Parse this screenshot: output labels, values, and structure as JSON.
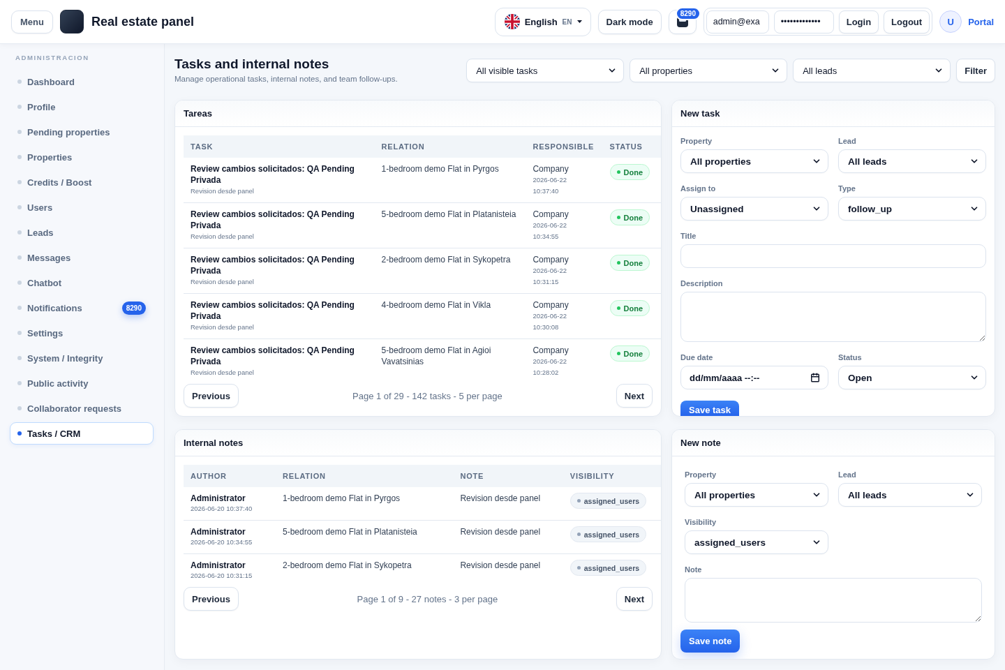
{
  "header": {
    "menu_button": "Menu",
    "brand": "Real estate panel",
    "language": {
      "label": "English",
      "code": "EN"
    },
    "dark_mode_button": "Dark mode",
    "notification_badge": "8290",
    "login": {
      "email": {
        "value": "admin@exa"
      },
      "password": {
        "value": "•••••••••••••"
      },
      "login_button": "Login",
      "logout_button": "Logout"
    },
    "avatar": "U",
    "portal_link": "Portal"
  },
  "sidebar": {
    "section": "ADMINISTRACION",
    "items": [
      {
        "label": "Dashboard",
        "selected": false
      },
      {
        "label": "Profile",
        "selected": false
      },
      {
        "label": "Pending properties",
        "selected": false
      },
      {
        "label": "Properties",
        "selected": false
      },
      {
        "label": "Credits / Boost",
        "selected": false
      },
      {
        "label": "Users",
        "selected": false
      },
      {
        "label": "Leads",
        "selected": false
      },
      {
        "label": "Messages",
        "selected": false
      },
      {
        "label": "Chatbot",
        "selected": false
      },
      {
        "label": "Notifications",
        "selected": false,
        "badge": "8290"
      },
      {
        "label": "Settings",
        "selected": false
      },
      {
        "label": "System / Integrity",
        "selected": false
      },
      {
        "label": "Public activity",
        "selected": false
      },
      {
        "label": "Collaborator requests",
        "selected": false
      },
      {
        "label": "Tasks / CRM",
        "selected": true
      }
    ]
  },
  "page": {
    "title": "Tasks and internal notes",
    "subtitle": "Manage operational tasks, internal notes, and team follow-ups.",
    "filters": [
      "All visible tasks",
      "All properties",
      "All leads"
    ],
    "filter_button": "Filter"
  },
  "tasks": {
    "title": "Tareas",
    "columns": [
      "TASK",
      "RELATION",
      "RESPONSIBLE",
      "STATUS"
    ],
    "rows": [
      {
        "title": "Review cambios solicitados: QA Pending Privada",
        "note": "Revision desde panel",
        "relation": "1-bedroom demo Flat in Pyrgos",
        "responsible": "Company",
        "timestamp": "2026-06-22 10:37:40",
        "status": "Done"
      },
      {
        "title": "Review cambios solicitados: QA Pending Privada",
        "note": "Revision desde panel",
        "relation": "5-bedroom demo Flat in Platanisteia",
        "responsible": "Company",
        "timestamp": "2026-06-22 10:34:55",
        "status": "Done"
      },
      {
        "title": "Review cambios solicitados: QA Pending Privada",
        "note": "Revision desde panel",
        "relation": "2-bedroom demo Flat in Sykopetra",
        "responsible": "Company",
        "timestamp": "2026-06-22 10:31:15",
        "status": "Done"
      },
      {
        "title": "Review cambios solicitados: QA Pending Privada",
        "note": "Revision desde panel",
        "relation": "4-bedroom demo Flat in Vikla",
        "responsible": "Company",
        "timestamp": "2026-06-22 10:30:08",
        "status": "Done"
      },
      {
        "title": "Review cambios solicitados: QA Pending Privada",
        "note": "Revision desde panel",
        "relation": "5-bedroom demo Flat in Agioi Vavatsinias",
        "responsible": "Company",
        "timestamp": "2026-06-22 10:28:02",
        "status": "Done"
      }
    ],
    "pagination": {
      "previous": "Previous",
      "info": "Page 1 of 29 - 142 tasks - 5 per page",
      "next": "Next"
    }
  },
  "new_task": {
    "title": "New task",
    "fields": [
      {
        "kind": "select",
        "label": "Property",
        "value": "All properties"
      },
      {
        "kind": "select",
        "label": "Lead",
        "value": "All leads"
      },
      {
        "kind": "select",
        "label": "Assign to",
        "value": "Unassigned"
      },
      {
        "kind": "select",
        "label": "Type",
        "value": "follow_up"
      },
      {
        "kind": "text",
        "label": "Title"
      },
      {
        "kind": "textarea",
        "label": "Description"
      },
      {
        "kind": "datetime",
        "label": "Due date",
        "placeholder": "dd/mm/aaaa --:--"
      },
      {
        "kind": "select",
        "label": "Status",
        "value": "Open"
      }
    ],
    "submit": "Save task"
  },
  "notes": {
    "title": "Internal notes",
    "columns": [
      "AUTHOR",
      "RELATION",
      "NOTE",
      "VISIBILITY"
    ],
    "rows": [
      {
        "author": "Administrator",
        "timestamp": "2026-06-20 10:37:40",
        "relation": "1-bedroom demo Flat in Pyrgos",
        "note": "Revision desde panel",
        "visibility": "assigned_users"
      },
      {
        "author": "Administrator",
        "timestamp": "2026-06-20 10:34:55",
        "relation": "5-bedroom demo Flat in Platanisteia",
        "note": "Revision desde panel",
        "visibility": "assigned_users"
      },
      {
        "author": "Administrator",
        "timestamp": "2026-06-20 10:31:15",
        "relation": "2-bedroom demo Flat in Sykopetra",
        "note": "Revision desde panel",
        "visibility": "assigned_users"
      }
    ],
    "pagination": {
      "previous": "Previous",
      "info": "Page 1 of 9 - 27 notes - 3 per page",
      "next": "Next"
    }
  },
  "new_note": {
    "title": "New note",
    "fields": [
      {
        "kind": "select",
        "label": "Property",
        "value": "All properties"
      },
      {
        "kind": "select",
        "label": "Lead",
        "value": "All leads"
      },
      {
        "kind": "select",
        "label": "Visibility",
        "value": "assigned_users"
      },
      {
        "kind": "textarea",
        "label": "Note"
      }
    ],
    "submit": "Save note"
  }
}
